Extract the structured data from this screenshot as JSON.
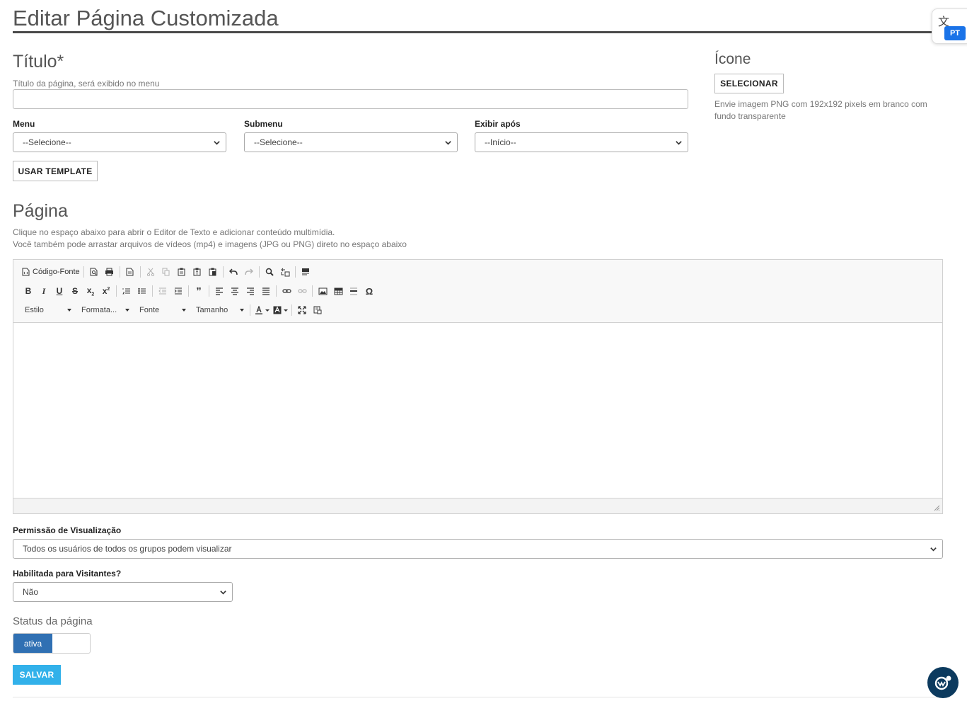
{
  "page_title": "Editar Página Customizada",
  "title_section": {
    "heading": "Título*",
    "help": "Título da página, será exibido no menu",
    "input_value": ""
  },
  "menu": {
    "label": "Menu",
    "value": "--Selecione--"
  },
  "submenu": {
    "label": "Submenu",
    "value": "--Selecione--"
  },
  "exibir_apos": {
    "label": "Exibir após",
    "value": "--Início--"
  },
  "use_template_label": "USAR TEMPLATE",
  "icon_section": {
    "heading": "Ícone",
    "button_label": "SELECIONAR",
    "help": "Envie imagem PNG com 192x192 pixels em branco com fundo transparente"
  },
  "page_section": {
    "heading": "Página",
    "help_line1": "Clique no espaço abaixo para abrir o Editor de Texto e adicionar conteúdo multimídia.",
    "help_line2": "Você também pode arrastar arquivos de vídeos (mp4) e imagens (JPG ou PNG) direto no espaço abaixo"
  },
  "editor": {
    "source_label": "Código-Fonte",
    "combos": {
      "style": "Estilo",
      "format": "Formata...",
      "font": "Fonte",
      "size": "Tamanho"
    },
    "icons": [
      "preview-icon",
      "print-icon",
      "templates-icon",
      "cut-icon",
      "copy-icon",
      "paste-icon",
      "paste-text-icon",
      "paste-word-icon",
      "undo-icon",
      "redo-icon",
      "find-icon",
      "replace-icon",
      "show-blocks-icon",
      "bold-icon",
      "italic-icon",
      "underline-icon",
      "strike-icon",
      "subscript-icon",
      "superscript-icon",
      "numbered-list-icon",
      "bulleted-list-icon",
      "outdent-icon",
      "indent-icon",
      "blockquote-icon",
      "align-left-icon",
      "align-center-icon",
      "align-right-icon",
      "justify-icon",
      "link-icon",
      "unlink-icon",
      "image-icon",
      "table-icon",
      "horizontal-rule-icon",
      "special-char-icon",
      "text-color-icon",
      "bg-color-icon",
      "maximize-icon",
      "about-icon"
    ]
  },
  "permission": {
    "label": "Permissão de Visualização",
    "value": "Todos os usuários de todos os grupos podem visualizar"
  },
  "visitors": {
    "label": "Habilitada para Visitantes?",
    "value": "Não"
  },
  "status": {
    "label": "Status da página",
    "toggle_on_label": "ativa",
    "active": true
  },
  "save_label": "SALVAR",
  "translate_widget": {
    "lang": "PT"
  },
  "colors": {
    "primary": "#3070b3",
    "save": "#32b1ea",
    "chat": "#0c3a5e",
    "lang_badge": "#1a73e8"
  }
}
